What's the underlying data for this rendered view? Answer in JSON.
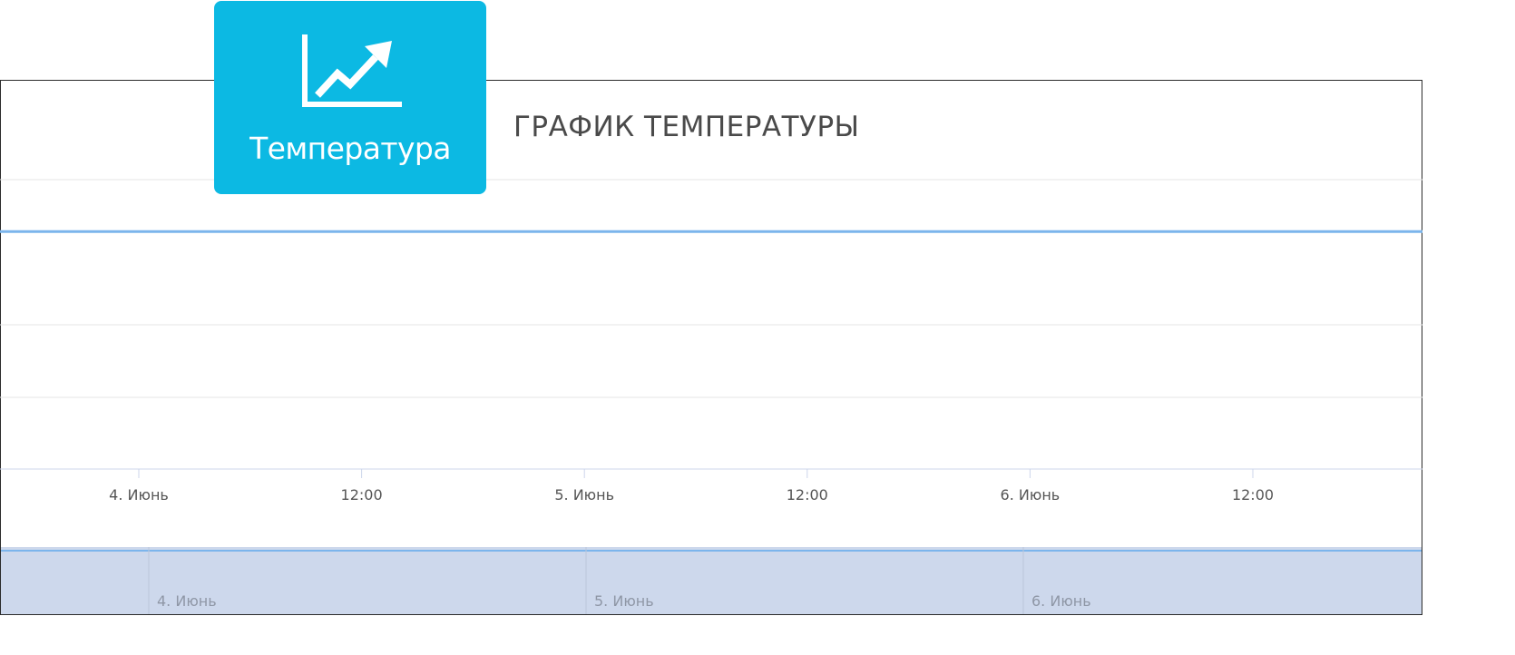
{
  "tile": {
    "label": "Температура",
    "icon": "line-chart-icon",
    "background": "#0cb9e3"
  },
  "chart_data": {
    "type": "line",
    "title": "ГРАФИК ТЕМПЕРАТУРЫ",
    "xlabel": "",
    "ylabel": "",
    "x_ticks": [
      "4. Июнь",
      "12:00",
      "5. Июнь",
      "12:00",
      "6. Июнь",
      "12:00"
    ],
    "navigator_ticks": [
      "4. Июнь",
      "5. Июнь",
      "6. Июнь"
    ],
    "grid": true,
    "legend": "none",
    "series_color": "#7cb5ec",
    "series": [
      {
        "values": [
          1,
          1
        ]
      }
    ]
  }
}
